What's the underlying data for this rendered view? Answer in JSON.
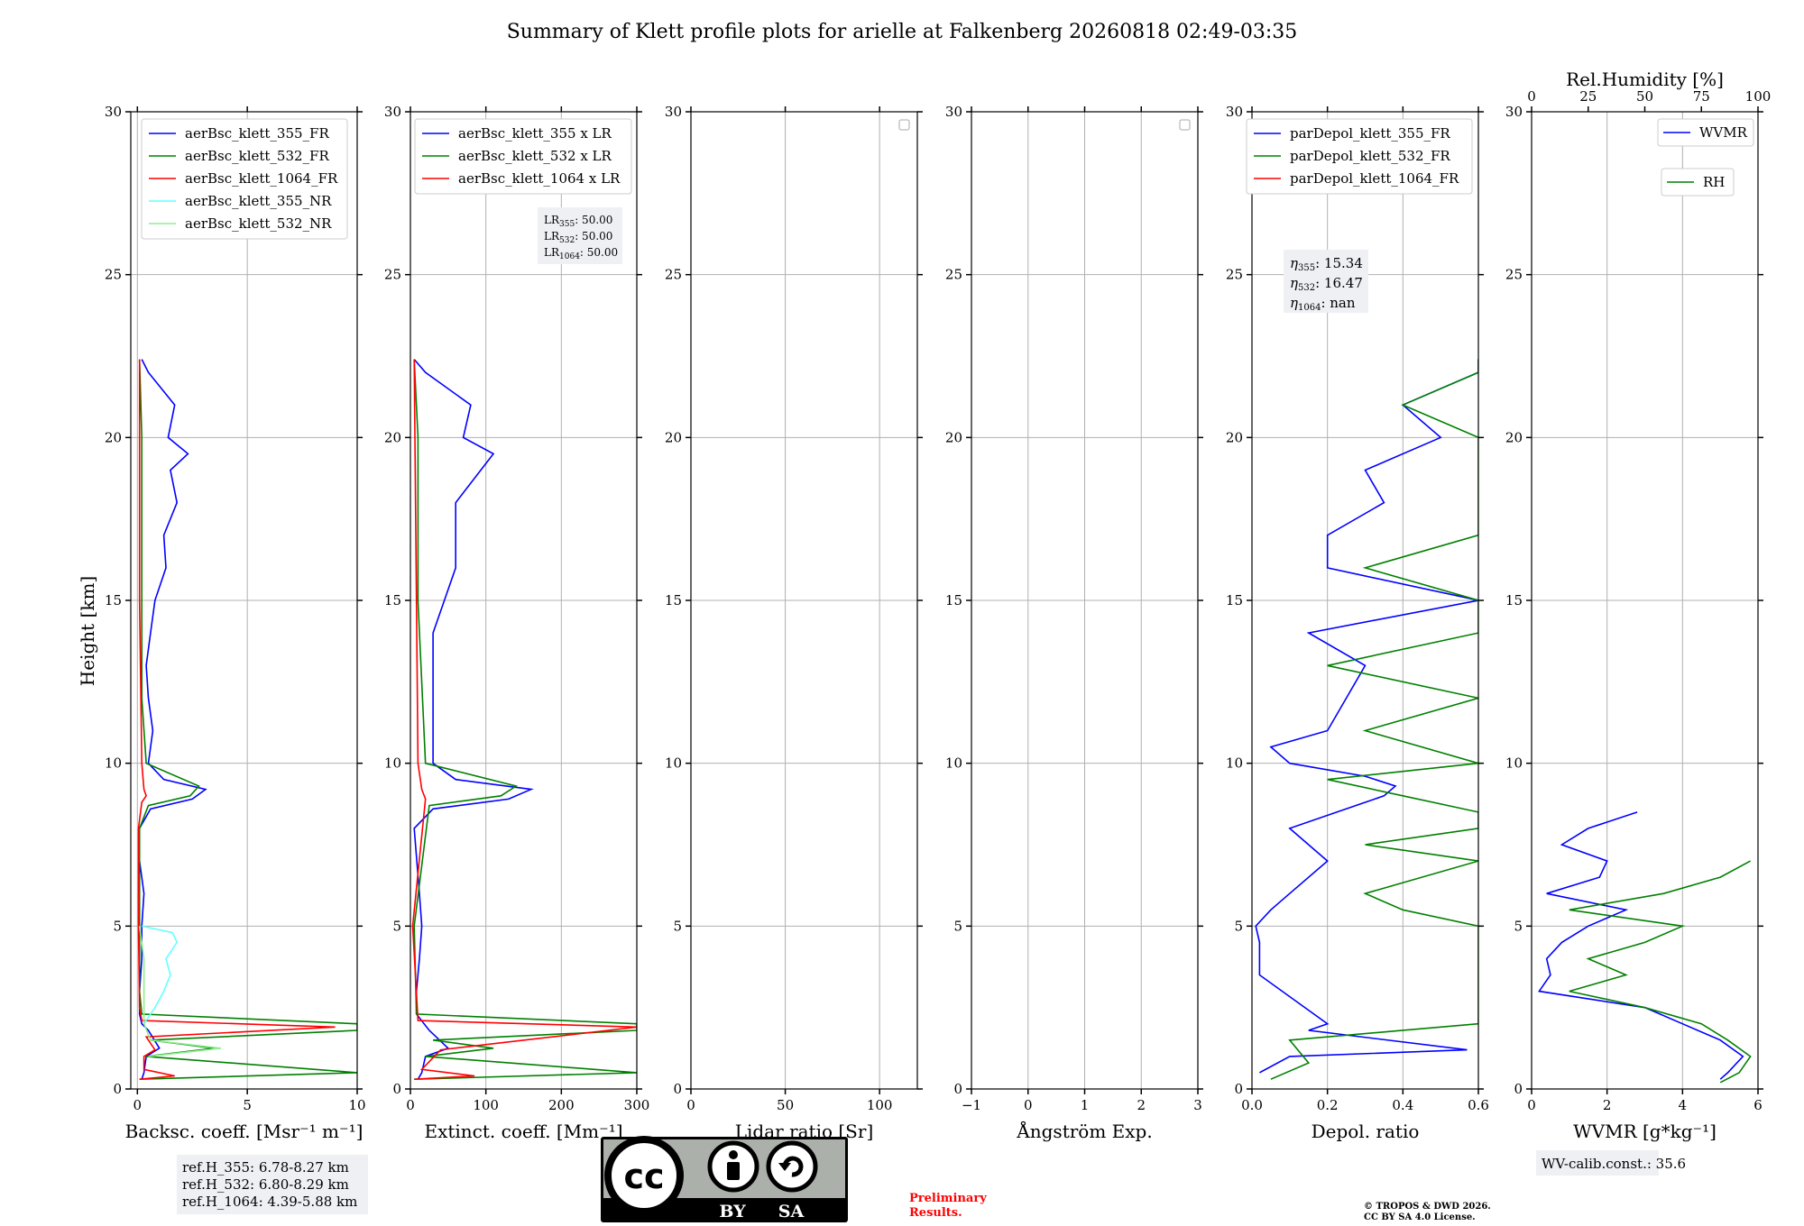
{
  "title": "Summary of Klett profile plots for arielle at Falkenberg 20260818 02:49-03:35",
  "y_axis": {
    "label": "Height [km]",
    "range": [
      0,
      30
    ],
    "ticks": [
      0,
      5,
      10,
      15,
      20,
      25,
      30
    ]
  },
  "colors": {
    "b355": "#0000ff",
    "g532": "#008000",
    "r1064": "#ff0000",
    "c355nr": "#66ffff",
    "lg532nr": "#90ee90",
    "prelim": "#ff0000"
  },
  "panels": [
    {
      "xlabel": "Backsc. coeff. [Msr⁻¹ m⁻¹]",
      "xrange": [
        -0.3,
        10
      ],
      "xticks": [
        0,
        5,
        10
      ],
      "legend": [
        "aerBsc_klett_355_FR",
        "aerBsc_klett_532_FR",
        "aerBsc_klett_1064_FR",
        "aerBsc_klett_355_NR",
        "aerBsc_klett_532_NR"
      ]
    },
    {
      "xlabel": "Extinct. coeff. [Mm⁻¹]",
      "xrange": [
        0,
        300
      ],
      "xticks": [
        0,
        100,
        200,
        300
      ],
      "legend": [
        "aerBsc_klett_355 x LR",
        "aerBsc_klett_532 x LR",
        "aerBsc_klett_1064 x LR"
      ]
    },
    {
      "xlabel": "Lidar ratio [Sr]",
      "xrange": [
        0,
        120
      ],
      "xticks": [
        0,
        50,
        100
      ],
      "legend": []
    },
    {
      "xlabel": "Ångström Exp.",
      "xrange": [
        -1,
        3
      ],
      "xticks": [
        -1,
        0,
        1,
        2,
        3
      ],
      "legend": []
    },
    {
      "xlabel": "Depol. ratio",
      "xrange": [
        0,
        0.6
      ],
      "xticks": [
        0.0,
        0.2,
        0.4,
        0.6
      ],
      "xticklabels": [
        "0.0",
        "0.2",
        "0.4",
        "0.6"
      ],
      "legend": [
        "parDepol_klett_355_FR",
        "parDepol_klett_532_FR",
        "parDepol_klett_1064_FR"
      ]
    },
    {
      "xlabel": "WVMR [g*kg⁻¹]",
      "xrange": [
        0,
        6
      ],
      "xticks": [
        0,
        2,
        4,
        6
      ],
      "top_label": "Rel.Humidity [%]",
      "top_ticks": [
        0,
        25,
        50,
        75,
        100
      ],
      "legend": [
        "WVMR",
        "RH"
      ]
    }
  ],
  "lr_box": {
    "prefix": "LR",
    "items": [
      [
        "355",
        ": 50.00"
      ],
      [
        "532",
        ": 50.00"
      ],
      [
        "1064",
        ": 50.00"
      ]
    ]
  },
  "eta_box": {
    "items": [
      [
        "355",
        ": 15.34"
      ],
      [
        "532",
        ": 16.47"
      ],
      [
        "1064",
        ": nan"
      ]
    ]
  },
  "ref_box": [
    "ref.H_355: 6.78-8.27 km",
    "ref.H_532: 6.80-8.29 km",
    "ref.H_1064: 4.39-5.88 km"
  ],
  "wv_calib": "WV-calib.const.: 35.6",
  "license": {
    "cc": "cc",
    "by": "BY",
    "sa": "SA"
  },
  "preliminary": [
    "Preliminary",
    "Results."
  ],
  "copyright": [
    "© TROPOS & DWD 2026.",
    "CC BY SA 4.0 License."
  ],
  "chart_data": {
    "type": "line",
    "title": "Summary of Klett profile plots for arielle at Falkenberg 20260818 02:49-03:35",
    "ylabel": "Height [km]",
    "ylim": [
      0,
      30
    ],
    "panels": [
      {
        "xlabel": "Backsc. coeff. [Msr⁻¹ m⁻¹]",
        "xlim": [
          -0.3,
          10
        ],
        "series": [
          {
            "name": "aerBsc_klett_355_FR",
            "color": "#0000ff",
            "height_km": [
              0.3,
              0.5,
              1.0,
              1.25,
              1.8,
              2.0,
              2.3,
              3,
              4,
              5,
              6,
              7,
              8,
              8.6,
              8.9,
              9.2,
              9.5,
              10,
              11,
              12,
              13,
              14,
              15,
              16,
              17,
              18,
              19,
              19.5,
              20,
              21,
              22,
              22.4
            ],
            "values": [
              0.2,
              0.3,
              0.4,
              1.0,
              0.5,
              0.2,
              0.1,
              0.1,
              0.2,
              0.2,
              0.3,
              0.1,
              0.1,
              0.6,
              2.5,
              3.1,
              1.2,
              0.5,
              0.7,
              0.5,
              0.4,
              0.6,
              0.8,
              1.3,
              1.2,
              1.8,
              1.5,
              2.3,
              1.4,
              1.7,
              0.5,
              0.2
            ]
          },
          {
            "name": "aerBsc_klett_532_FR",
            "color": "#008000",
            "height_km": [
              0.3,
              0.5,
              1.0,
              1.25,
              1.5,
              1.8,
              2.0,
              2.3,
              3,
              5,
              8,
              8.7,
              9.0,
              9.3,
              10,
              12,
              15,
              18,
              20,
              22.4
            ],
            "values": [
              0.1,
              10.0,
              0.4,
              3.5,
              0.6,
              10.0,
              10.0,
              0.2,
              0.1,
              0.1,
              0.1,
              0.5,
              2.4,
              2.8,
              0.4,
              0.2,
              0.2,
              0.2,
              0.2,
              0.1
            ]
          },
          {
            "name": "aerBsc_klett_1064_FR",
            "color": "#ff0000",
            "height_km": [
              0.3,
              0.4,
              0.6,
              1.0,
              1.2,
              1.6,
              1.9,
              2.1,
              2.5,
              5,
              8,
              8.8,
              9.0,
              9.2,
              10,
              15,
              20,
              22.4
            ],
            "values": [
              0.1,
              1.7,
              0.3,
              0.3,
              0.8,
              0.4,
              9.0,
              0.2,
              0.1,
              0.05,
              0.05,
              0.2,
              0.4,
              0.3,
              0.2,
              0.1,
              0.1,
              0.1
            ]
          },
          {
            "name": "aerBsc_klett_355_NR",
            "color": "#66ffff",
            "height_km": [
              2.0,
              2.5,
              3.0,
              3.5,
              4.0,
              4.5,
              4.8,
              5.0
            ],
            "values": [
              0.3,
              0.8,
              1.2,
              1.5,
              1.3,
              1.8,
              1.6,
              0.2
            ]
          },
          {
            "name": "aerBsc_klett_532_NR",
            "color": "#90ee90",
            "height_km": [
              1.0,
              1.25,
              1.5,
              2.0,
              3.0,
              4.0,
              5.0
            ],
            "values": [
              0.5,
              3.8,
              0.6,
              0.3,
              0.3,
              0.3,
              0.1
            ]
          }
        ]
      },
      {
        "xlabel": "Extinct. coeff. [Mm⁻¹]",
        "xlim": [
          0,
          300
        ],
        "series": [
          {
            "name": "aerBsc_klett_355 x LR",
            "color": "#0000ff",
            "height_km": [
              0.3,
              0.5,
              1.0,
              1.25,
              1.8,
              2.3,
              3,
              4,
              5,
              6,
              8,
              8.6,
              8.9,
              9.2,
              9.5,
              10,
              12,
              14,
              16,
              18,
              19.5,
              20,
              21,
              22,
              22.4
            ],
            "values": [
              10,
              15,
              20,
              50,
              25,
              8,
              8,
              12,
              15,
              12,
              5,
              30,
              130,
              160,
              60,
              30,
              30,
              30,
              60,
              60,
              110,
              70,
              80,
              20,
              5
            ]
          },
          {
            "name": "aerBsc_klett_532 x LR",
            "color": "#008000",
            "height_km": [
              0.3,
              0.5,
              1.0,
              1.25,
              1.5,
              1.8,
              2.0,
              2.3,
              5,
              8.7,
              9.0,
              9.3,
              10,
              15,
              20,
              22.4
            ],
            "values": [
              5,
              300,
              20,
              110,
              30,
              300,
              300,
              8,
              5,
              25,
              120,
              140,
              20,
              10,
              10,
              5
            ]
          },
          {
            "name": "aerBsc_klett_1064 x LR",
            "color": "#ff0000",
            "height_km": [
              0.3,
              0.4,
              0.6,
              1.2,
              1.9,
              2.1,
              5,
              8.9,
              9.2,
              10,
              22.4
            ],
            "values": [
              5,
              85,
              15,
              40,
              300,
              10,
              3,
              20,
              15,
              10,
              5
            ]
          }
        ]
      },
      {
        "xlabel": "Lidar ratio [Sr]",
        "xlim": [
          0,
          120
        ],
        "series": []
      },
      {
        "xlabel": "Ångström Exp.",
        "xlim": [
          -1,
          3
        ],
        "series": []
      },
      {
        "xlabel": "Depol. ratio",
        "xlim": [
          0,
          0.6
        ],
        "series": [
          {
            "name": "parDepol_klett_355_FR",
            "color": "#0000ff",
            "height_km": [
              0.5,
              1.0,
              1.2,
              1.8,
              2.0,
              3.5,
              4.5,
              5.0,
              5.5,
              6,
              7,
              8,
              9,
              9.3,
              9.6,
              10,
              10.5,
              11,
              12,
              13,
              14,
              15,
              16,
              17,
              18,
              19,
              20,
              21,
              22,
              22.4
            ],
            "values": [
              0.02,
              0.1,
              0.57,
              0.15,
              0.2,
              0.02,
              0.02,
              0.01,
              0.05,
              0.1,
              0.2,
              0.1,
              0.35,
              0.38,
              0.3,
              0.1,
              0.05,
              0.2,
              0.25,
              0.3,
              0.15,
              0.6,
              0.2,
              0.2,
              0.35,
              0.3,
              0.5,
              0.4,
              0.6,
              0.6
            ]
          },
          {
            "name": "parDepol_klett_532_FR",
            "color": "#008000",
            "height_km": [
              0.3,
              0.8,
              1.5,
              2.0,
              5.0,
              5.5,
              6,
              7,
              7.5,
              8,
              8.5,
              9.0,
              9.5,
              10,
              11,
              12,
              13,
              14,
              15,
              16,
              17,
              18,
              19,
              20,
              21,
              22,
              22.4
            ],
            "values": [
              0.05,
              0.15,
              0.1,
              0.6,
              0.6,
              0.4,
              0.3,
              0.6,
              0.3,
              0.6,
              0.6,
              0.4,
              0.2,
              0.6,
              0.3,
              0.6,
              0.2,
              0.6,
              0.6,
              0.3,
              0.6,
              0.6,
              0.6,
              0.6,
              0.4,
              0.6,
              0.6
            ]
          },
          {
            "name": "parDepol_klett_1064_FR",
            "color": "#ff0000",
            "height_km": [],
            "values": []
          }
        ]
      },
      {
        "xlabel": "WVMR [g*kg⁻¹]",
        "xlim": [
          0,
          6
        ],
        "top_axis": {
          "label": "Rel.Humidity [%]",
          "xlim": [
            0,
            100
          ]
        },
        "series": [
          {
            "name": "WVMR",
            "color": "#0000ff",
            "height_km": [
              0.3,
              0.5,
              1.0,
              1.5,
              2.0,
              2.5,
              3.0,
              3.5,
              4.0,
              4.5,
              5.0,
              5.5,
              6.0,
              6.5,
              7.0,
              7.5,
              8.0,
              8.5
            ],
            "values": [
              5.0,
              5.2,
              5.6,
              5.0,
              4.0,
              3.0,
              0.2,
              0.5,
              0.4,
              0.8,
              1.5,
              2.5,
              0.4,
              1.8,
              2.0,
              0.8,
              1.5,
              2.8
            ]
          },
          {
            "name": "RH",
            "color": "#008000",
            "height_km": [
              0.2,
              0.5,
              1.0,
              1.5,
              2.0,
              2.5,
              3.0,
              3.5,
              4.0,
              4.5,
              5.0,
              5.5,
              6.0,
              6.5,
              7.0
            ],
            "values": [
              5.0,
              5.5,
              5.8,
              5.2,
              4.5,
              3.0,
              1.0,
              2.5,
              1.5,
              3.0,
              4.0,
              1.0,
              3.5,
              5.0,
              5.8
            ]
          }
        ]
      }
    ]
  }
}
